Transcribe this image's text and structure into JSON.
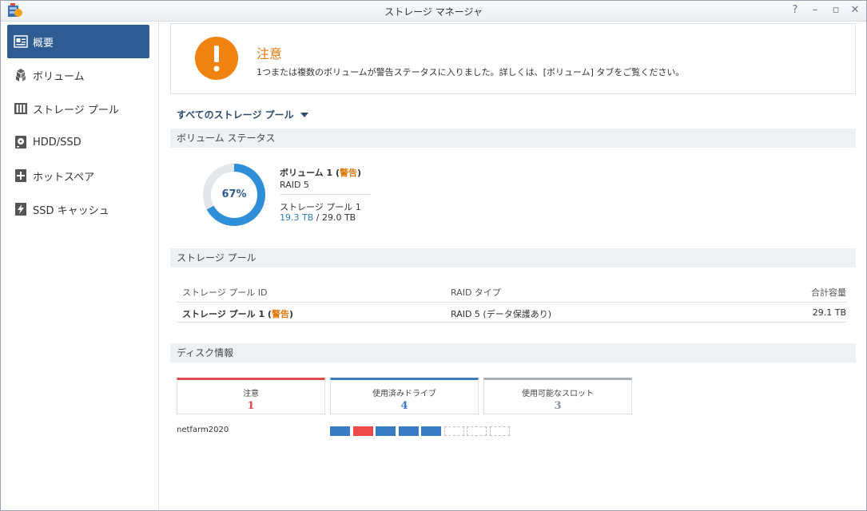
{
  "window": {
    "title": "ストレージ マネージャ"
  },
  "sidebar": {
    "items": [
      {
        "label": "概要",
        "icon": "overview-icon"
      },
      {
        "label": "ボリューム",
        "icon": "volume-icon"
      },
      {
        "label": "ストレージ プール",
        "icon": "storage-pool-icon"
      },
      {
        "label": "HDD/SSD",
        "icon": "hdd-icon"
      },
      {
        "label": "ホットスペア",
        "icon": "hot-spare-icon"
      },
      {
        "label": "SSD キャッシュ",
        "icon": "ssd-cache-icon"
      }
    ],
    "active_index": 0
  },
  "alert": {
    "title": "注意",
    "message": "1つまたは複数のボリュームが警告ステータスに入りました。詳しくは、[ボリューム] タブをご覧ください。"
  },
  "filter": {
    "label": "すべてのストレージ プール"
  },
  "volume_status": {
    "header": "ボリューム ステータス",
    "percent_label": "67%",
    "percent": 67,
    "name": "ボリューム 1",
    "status": "警告",
    "raid": "RAID 5",
    "pool": "ストレージ プール 1",
    "used": "19.3 TB",
    "total": "29.0 TB"
  },
  "storage_pool": {
    "header": "ストレージ プール",
    "columns": [
      "ストレージ プール ID",
      "RAID タイプ",
      "合計容量"
    ],
    "rows": [
      {
        "id": "ストレージ プール 1",
        "status": "警告",
        "raid": "RAID 5 (データ保護あり)",
        "capacity": "29.1 TB"
      }
    ]
  },
  "disk_info": {
    "header": "ディスク情報",
    "cards": [
      {
        "label": "注意",
        "value": "1",
        "color": "#e04b4b"
      },
      {
        "label": "使用済みドライブ",
        "value": "4",
        "color": "#3a7cc4"
      },
      {
        "label": "使用可能なスロット",
        "value": "3",
        "color": "#8a9099"
      }
    ],
    "host": "netfarm2020",
    "slots": [
      "used",
      "warning",
      "used",
      "used",
      "used",
      "empty",
      "empty",
      "empty"
    ]
  },
  "colors": {
    "accent": "#2e5c92",
    "warning": "#e07a10",
    "used": "#2e7dc4"
  }
}
